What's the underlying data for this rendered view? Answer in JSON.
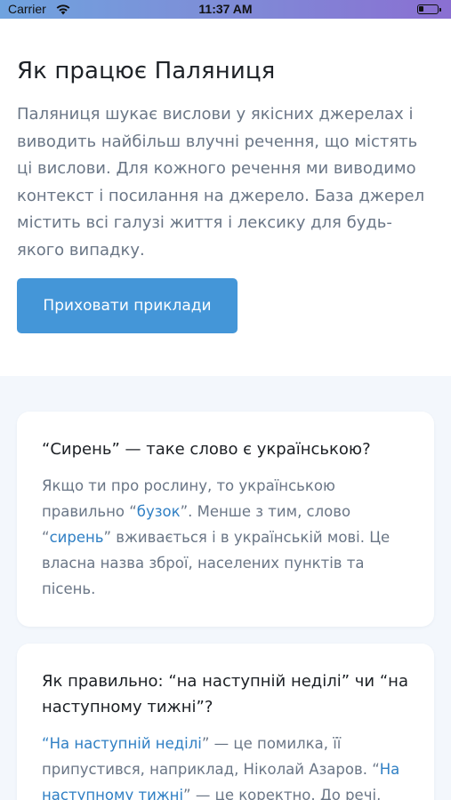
{
  "status_bar": {
    "carrier": "Carrier",
    "time": "11:37 AM",
    "battery_level": 0.25
  },
  "intro": {
    "title": "Як працює Паляниця",
    "description": "Паляниця шукає вислови у якісних джерелах і виводить найбільш влучні речення, що містять ці вислови. Для кожного речення ми виводимо контекст і посилання на джерело. База джерел містить всі галузі життя і лексику для будь-якого випадку."
  },
  "toggle_button": {
    "label": "Приховати приклади"
  },
  "examples": [
    {
      "question": "“Сирень” — таке слово є українською?",
      "t1": "Якщо ти про рослину, то українською правильно “",
      "link1": "бузок",
      "t2": "”. Менше з тим, слово “",
      "link2": "сирень",
      "t3": "” вживається і в українській мові. Це власна назва зброї, населених пунктів та пісень."
    },
    {
      "question": "Як правильно: “на наступній неділі” чи “на наступному тижні”?",
      "t0": "“",
      "link1": "На наступній неділі",
      "t1": "” — це помилка, її припустився, наприклад, Ніколай Азаров. “",
      "link2": "На наступному тижні",
      "t2": "” — це коректно. До речі,"
    }
  ],
  "colors": {
    "accent": "#4496d8",
    "link": "#2f7fc4",
    "text_muted": "#6a7686",
    "section_bg": "#f3f7fc"
  }
}
